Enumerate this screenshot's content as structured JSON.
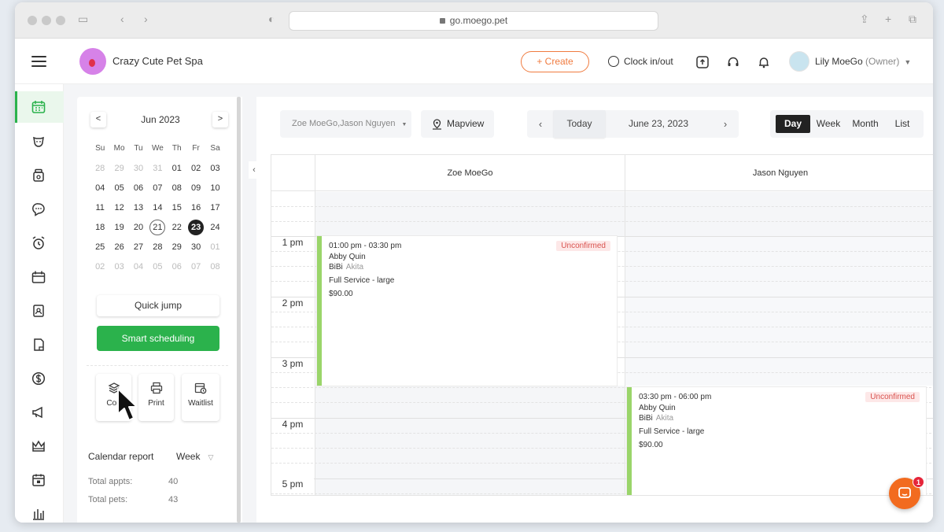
{
  "browser": {
    "url": "go.moego.pet"
  },
  "header": {
    "business_name": "Crazy Cute Pet Spa",
    "create_label": "+ Create",
    "clock_label": "Clock in/out",
    "user_name": "Lily MoeGo",
    "user_role": "(Owner)"
  },
  "mini_calendar": {
    "month_label": "Jun 2023",
    "prev": "<",
    "next": ">",
    "weekdays": [
      "Su",
      "Mo",
      "Tu",
      "We",
      "Th",
      "Fr",
      "Sa"
    ],
    "weeks": [
      [
        {
          "d": "28",
          "m": true
        },
        {
          "d": "29",
          "m": true
        },
        {
          "d": "30",
          "m": true
        },
        {
          "d": "31",
          "m": true
        },
        {
          "d": "01"
        },
        {
          "d": "02"
        },
        {
          "d": "03"
        }
      ],
      [
        {
          "d": "04"
        },
        {
          "d": "05"
        },
        {
          "d": "06"
        },
        {
          "d": "07"
        },
        {
          "d": "08"
        },
        {
          "d": "09"
        },
        {
          "d": "10"
        }
      ],
      [
        {
          "d": "11"
        },
        {
          "d": "12"
        },
        {
          "d": "13"
        },
        {
          "d": "14"
        },
        {
          "d": "15"
        },
        {
          "d": "16"
        },
        {
          "d": "17"
        }
      ],
      [
        {
          "d": "18"
        },
        {
          "d": "19"
        },
        {
          "d": "20"
        },
        {
          "d": "21",
          "today": true
        },
        {
          "d": "22"
        },
        {
          "d": "23",
          "selected": true
        },
        {
          "d": "24"
        }
      ],
      [
        {
          "d": "25"
        },
        {
          "d": "26"
        },
        {
          "d": "27"
        },
        {
          "d": "28"
        },
        {
          "d": "29"
        },
        {
          "d": "30"
        },
        {
          "d": "01",
          "m": true
        }
      ],
      [
        {
          "d": "02",
          "m": true
        },
        {
          "d": "03",
          "m": true
        },
        {
          "d": "04",
          "m": true
        },
        {
          "d": "05",
          "m": true
        },
        {
          "d": "06",
          "m": true
        },
        {
          "d": "07",
          "m": true
        },
        {
          "d": "08",
          "m": true
        }
      ]
    ]
  },
  "left_panel": {
    "quick_jump": "Quick jump",
    "smart_scheduling": "Smart scheduling",
    "tools": [
      {
        "label": "Con",
        "icon": "layers-icon"
      },
      {
        "label": "Print",
        "icon": "printer-icon"
      },
      {
        "label": "Waitlist",
        "icon": "calendar-clock-icon"
      }
    ],
    "report_label": "Calendar report",
    "report_range": "Week",
    "stats": [
      {
        "label": "Total appts:",
        "value": "40"
      },
      {
        "label": "Total pets:",
        "value": "43"
      }
    ]
  },
  "toolbar": {
    "staff_filter": "Zoe MoeGo,Jason Nguyen",
    "mapview": "Mapview",
    "today": "Today",
    "date": "June 23, 2023",
    "views": [
      "Day",
      "Week",
      "Month",
      "List"
    ],
    "active_view": "Day"
  },
  "schedule": {
    "staff": [
      "Zoe MoeGo",
      "Jason Nguyen"
    ],
    "time_labels": [
      "1 pm",
      "2 pm",
      "3 pm",
      "4 pm",
      "5 pm"
    ],
    "appointments": [
      {
        "time": "01:00 pm - 03:30 pm",
        "status": "Unconfirmed",
        "client": "Abby Quin",
        "pet": "BiBi",
        "breed": "Akita",
        "service": "Full Service - large",
        "price": "$90.00"
      },
      {
        "time": "03:30 pm - 06:00 pm",
        "status": "Unconfirmed",
        "client": "Abby Quin",
        "pet": "BiBi",
        "breed": "Akita",
        "service": "Full Service - large",
        "price": "$90.00"
      }
    ]
  },
  "chat": {
    "badge": "1"
  },
  "colors": {
    "brand_green": "#2bb24c",
    "accent_orange": "#f07b3f",
    "event_bar": "#9ad56a",
    "status_red": "#d9534f"
  }
}
